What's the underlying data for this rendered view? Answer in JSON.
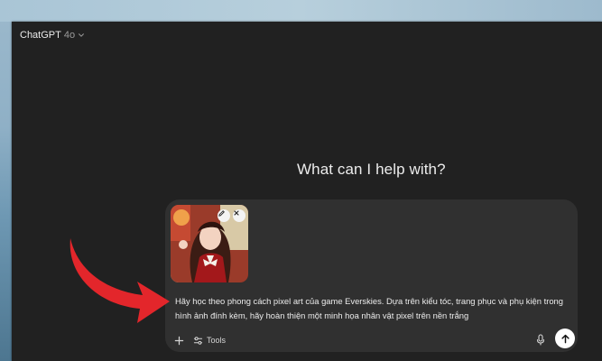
{
  "app": {
    "model_name": "ChatGPT",
    "model_version": "4o"
  },
  "main": {
    "heading": "What can I help with?"
  },
  "composer": {
    "attachment": {
      "type": "image",
      "subject": "photo of a girl in a red outfit with a white bow"
    },
    "prompt_text": "Hãy học theo phong cách pixel art của game Everskies. Dựa trên kiểu tóc, trang phục và phụ kiện trong hình ảnh đính kèm, hãy hoàn thiện một minh họa nhân vật pixel trên nền trắng",
    "tools_label": "Tools"
  },
  "icons": {
    "model_dropdown": "chevron-down-icon",
    "attachment_edit": "pencil-icon",
    "attachment_remove": "close-icon",
    "add": "plus-icon",
    "tools": "sliders-icon",
    "voice": "microphone-icon",
    "send": "arrow-up-icon"
  },
  "annotation": {
    "type": "red curved arrow pointing at prompt text",
    "color": "#e3262b"
  },
  "colors": {
    "window_background": "#212121",
    "composer_background": "#303030",
    "text_primary": "#ececec",
    "send_button": "#ffffff"
  }
}
